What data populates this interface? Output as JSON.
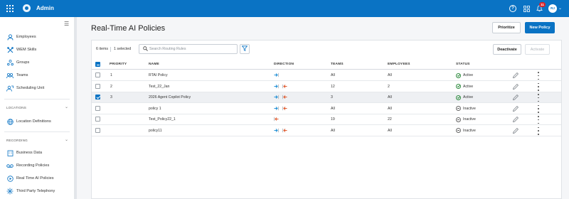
{
  "topbar": {
    "app_title": "Admin",
    "notification_count": "11",
    "avatar_initials": "RJ",
    "bg_color": "#0a73c4"
  },
  "sidebar": {
    "items": [
      {
        "label": "Employees",
        "icon": "person-icon"
      },
      {
        "label": "WEM Skills",
        "icon": "tools-icon"
      },
      {
        "label": "Groups",
        "icon": "group-icon"
      },
      {
        "label": "Teams",
        "icon": "teams-icon"
      },
      {
        "label": "Scheduling Unit",
        "icon": "scheduling-icon"
      }
    ],
    "section_location": "LOCATIONS",
    "location_items": [
      {
        "label": "Location Definitions",
        "icon": "globe-icon"
      }
    ],
    "section_recording": "RECORDING",
    "recording_items": [
      {
        "label": "Business Data",
        "icon": "building-icon"
      },
      {
        "label": "Recording Policies",
        "icon": "tape-icon"
      },
      {
        "label": "Real Time AI Policies",
        "icon": "play-circle-icon"
      },
      {
        "label": "Third Party Telephony",
        "icon": "network-icon"
      }
    ]
  },
  "page": {
    "title": "Real-Time AI Policies",
    "prioritize_label": "Prioritize",
    "new_policy_label": "New Policy",
    "deactivate_label": "Deactivate",
    "activate_label": "Activate"
  },
  "toolbar": {
    "items_count": "6 items",
    "selected_count": "1 selected",
    "search_placeholder": "Search Routing Rules"
  },
  "table": {
    "columns": [
      "PRIORITY",
      "NAME",
      "DIRECTION",
      "TEAMS",
      "EMPLOYEES",
      "STATUS"
    ],
    "rows": [
      {
        "priority": "1",
        "name": "RTAI Policy",
        "direction": [
          "in"
        ],
        "teams": "All",
        "employees": "All",
        "status": "Active",
        "checked": false
      },
      {
        "priority": "2",
        "name": "Test_22_Jan",
        "direction": [
          "in",
          "out"
        ],
        "teams": "12",
        "employees": "2",
        "status": "Active",
        "checked": false
      },
      {
        "priority": "3",
        "name": "2026 Agent Copilot Policy",
        "direction": [
          "in",
          "out"
        ],
        "teams": "3",
        "employees": "All",
        "status": "Active",
        "checked": true
      },
      {
        "priority": "",
        "name": "policy 1",
        "direction": [
          "in",
          "out"
        ],
        "teams": "All",
        "employees": "All",
        "status": "Inactive",
        "checked": false
      },
      {
        "priority": "",
        "name": "Test_Policy22_1",
        "direction": [
          "out"
        ],
        "teams": "19",
        "employees": "22",
        "status": "Inactive",
        "checked": false
      },
      {
        "priority": "",
        "name": "policy11",
        "direction": [
          "in",
          "out"
        ],
        "teams": "All",
        "employees": "All",
        "status": "Inactive",
        "checked": false
      }
    ]
  },
  "colors": {
    "accent": "#0a73c4",
    "inbound": "#1e8fd6",
    "outbound": "#e0582b",
    "active": "#2e8b3e"
  }
}
